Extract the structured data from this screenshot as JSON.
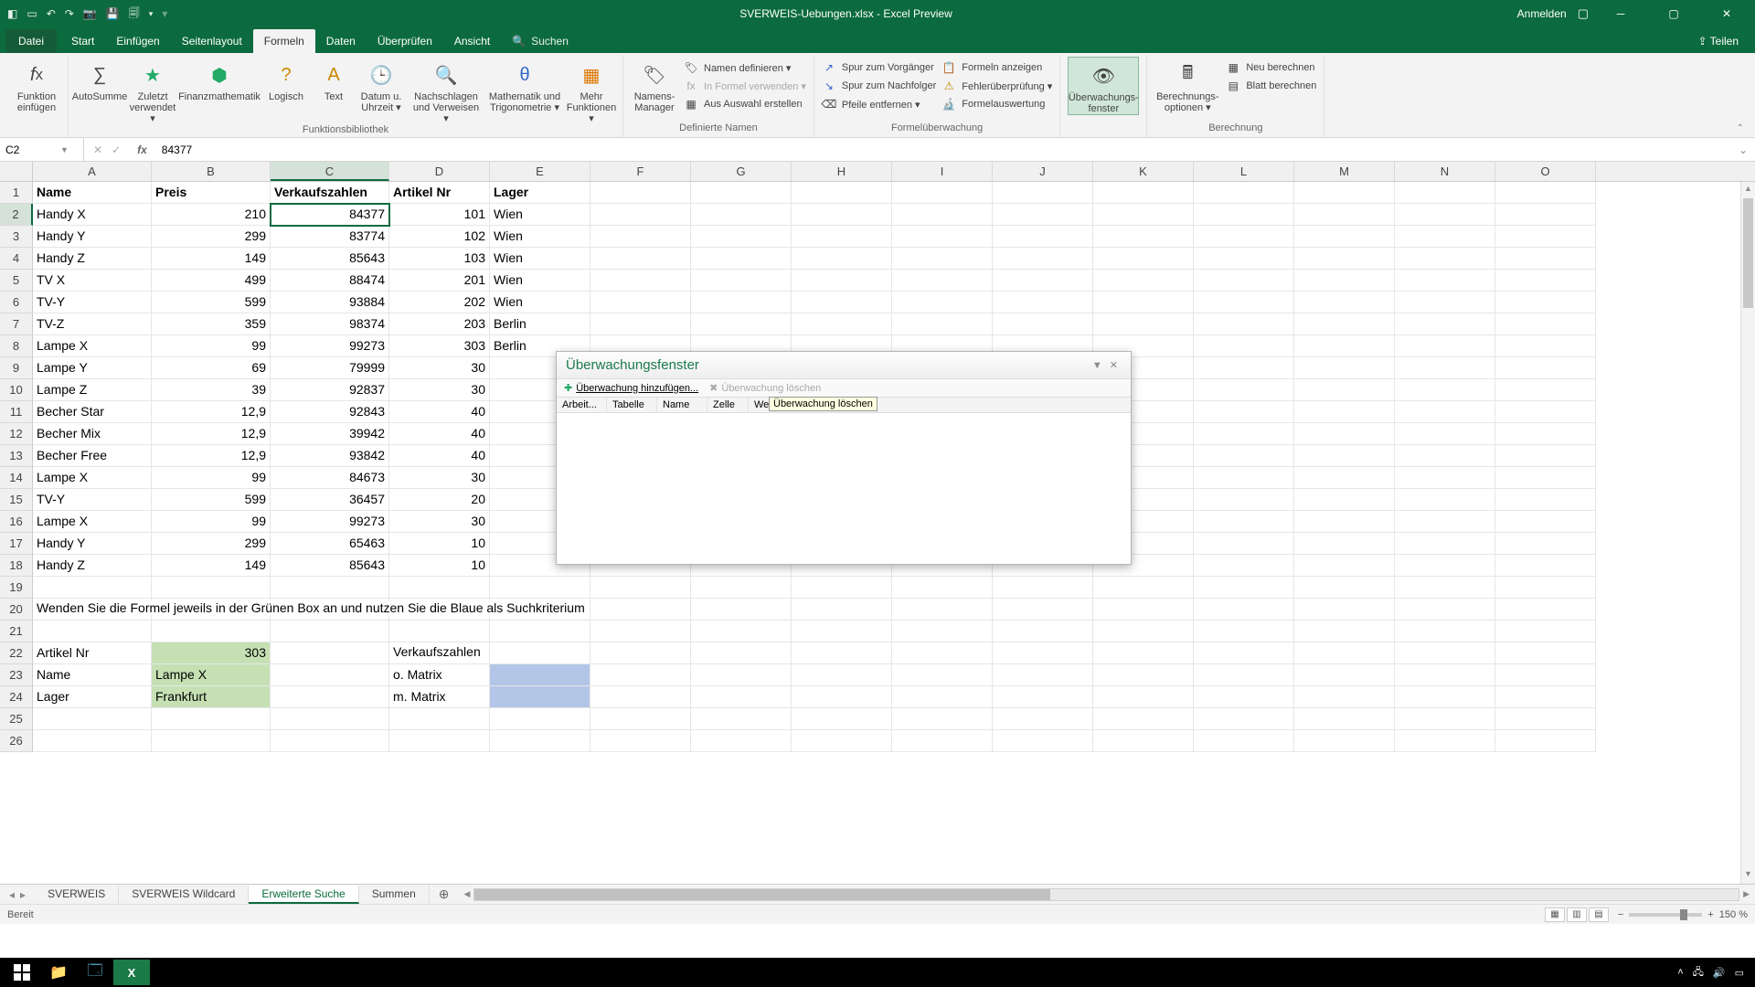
{
  "titlebar": {
    "filename": "SVERWEIS-Uebungen.xlsx - Excel Preview",
    "login": "Anmelden"
  },
  "tabs": {
    "file": "Datei",
    "start": "Start",
    "einfuegen": "Einfügen",
    "seitenlayout": "Seitenlayout",
    "formeln": "Formeln",
    "daten": "Daten",
    "ueberpruefen": "Überprüfen",
    "ansicht": "Ansicht",
    "suchen": "Suchen",
    "teilen": "Teilen"
  },
  "ribbon": {
    "funktion_einfuegen": "Funktion\neinfügen",
    "autosumme": "AutoSumme",
    "zuletzt": "Zuletzt\nverwendet ▾",
    "finanz": "Finanzmathematik",
    "logisch": "Logisch",
    "text": "Text",
    "datum": "Datum u.\nUhrzeit ▾",
    "nachschlagen": "Nachschlagen\nund Verweisen ▾",
    "math": "Mathematik und\nTrigonometrie ▾",
    "mehr": "Mehr\nFunktionen ▾",
    "group_bib": "Funktionsbibliothek",
    "namens_manager": "Namens-\nManager",
    "namen_def": "Namen definieren ▾",
    "in_formel": "In Formel verwenden ▾",
    "aus_auswahl": "Aus Auswahl erstellen",
    "group_namen": "Definierte Namen",
    "spur_vor": "Spur zum Vorgänger",
    "spur_nach": "Spur zum Nachfolger",
    "pfeile": "Pfeile entfernen ▾",
    "formeln_anz": "Formeln anzeigen",
    "fehler": "Fehlerüberprüfung ▾",
    "auswertung": "Formelauswertung",
    "group_ueberw": "Formelüberwachung",
    "ueberwachung": "Überwachungs-\nfenster",
    "berechnung_opt": "Berechnungs-\noptionen ▾",
    "neu_berechnen": "Neu berechnen",
    "blatt_berechnen": "Blatt berechnen",
    "group_berechnung": "Berechnung"
  },
  "formula_bar": {
    "cell_ref": "C2",
    "value": "84377"
  },
  "columns": [
    "A",
    "B",
    "C",
    "D",
    "E",
    "F",
    "G",
    "H",
    "I",
    "J",
    "K",
    "L",
    "M",
    "N",
    "O"
  ],
  "headers": {
    "A": "Name",
    "B": "Preis",
    "C": "Verkaufszahlen",
    "D": "Artikel Nr",
    "E": "Lager"
  },
  "data_rows": [
    {
      "A": "Handy X",
      "B": "210",
      "C": "84377",
      "D": "101",
      "E": "Wien"
    },
    {
      "A": "Handy Y",
      "B": "299",
      "C": "83774",
      "D": "102",
      "E": "Wien"
    },
    {
      "A": "Handy Z",
      "B": "149",
      "C": "85643",
      "D": "103",
      "E": "Wien"
    },
    {
      "A": "TV X",
      "B": "499",
      "C": "88474",
      "D": "201",
      "E": "Wien"
    },
    {
      "A": "TV-Y",
      "B": "599",
      "C": "93884",
      "D": "202",
      "E": "Wien"
    },
    {
      "A": "TV-Z",
      "B": "359",
      "C": "98374",
      "D": "203",
      "E": "Berlin"
    },
    {
      "A": "Lampe X",
      "B": "99",
      "C": "99273",
      "D": "303",
      "E": "Berlin"
    },
    {
      "A": "Lampe Y",
      "B": "69",
      "C": "79999",
      "D": "30",
      "E": ""
    },
    {
      "A": "Lampe Z",
      "B": "39",
      "C": "92837",
      "D": "30",
      "E": ""
    },
    {
      "A": "Becher Star",
      "B": "12,9",
      "C": "92843",
      "D": "40",
      "E": ""
    },
    {
      "A": "Becher Mix",
      "B": "12,9",
      "C": "39942",
      "D": "40",
      "E": ""
    },
    {
      "A": "Becher Free",
      "B": "12,9",
      "C": "93842",
      "D": "40",
      "E": ""
    },
    {
      "A": "Lampe X",
      "B": "99",
      "C": "84673",
      "D": "30",
      "E": ""
    },
    {
      "A": "TV-Y",
      "B": "599",
      "C": "36457",
      "D": "20",
      "E": ""
    },
    {
      "A": "Lampe X",
      "B": "99",
      "C": "99273",
      "D": "30",
      "E": ""
    },
    {
      "A": "Handy Y",
      "B": "299",
      "C": "65463",
      "D": "10",
      "E": ""
    },
    {
      "A": "Handy Z",
      "B": "149",
      "C": "85643",
      "D": "10",
      "E": ""
    }
  ],
  "instruction": "Wenden Sie die Formel jeweils in der Grünen Box an und nutzen Sie die Blaue als Suchkriterium",
  "lookup": {
    "r22": {
      "A": "Artikel Nr",
      "B": "303",
      "D": "Verkaufszahlen"
    },
    "r23": {
      "A": "Name",
      "B": "Lampe X",
      "D": "o. Matrix"
    },
    "r24": {
      "A": "Lager",
      "B": "Frankfurt",
      "D": "m. Matrix"
    }
  },
  "watch": {
    "title": "Überwachungsfenster",
    "add": "Überwachung hinzufügen...",
    "del": "Überwachung löschen",
    "cols": {
      "arbeit": "Arbeit...",
      "tabelle": "Tabelle",
      "name": "Name",
      "zelle": "Zelle",
      "wert": "We"
    },
    "tooltip": "Überwachung löschen"
  },
  "sheets": {
    "s1": "SVERWEIS",
    "s2": "SVERWEIS Wildcard",
    "s3": "Erweiterte Suche",
    "s4": "Summen"
  },
  "status": {
    "ready": "Bereit",
    "zoom": "150 %"
  }
}
